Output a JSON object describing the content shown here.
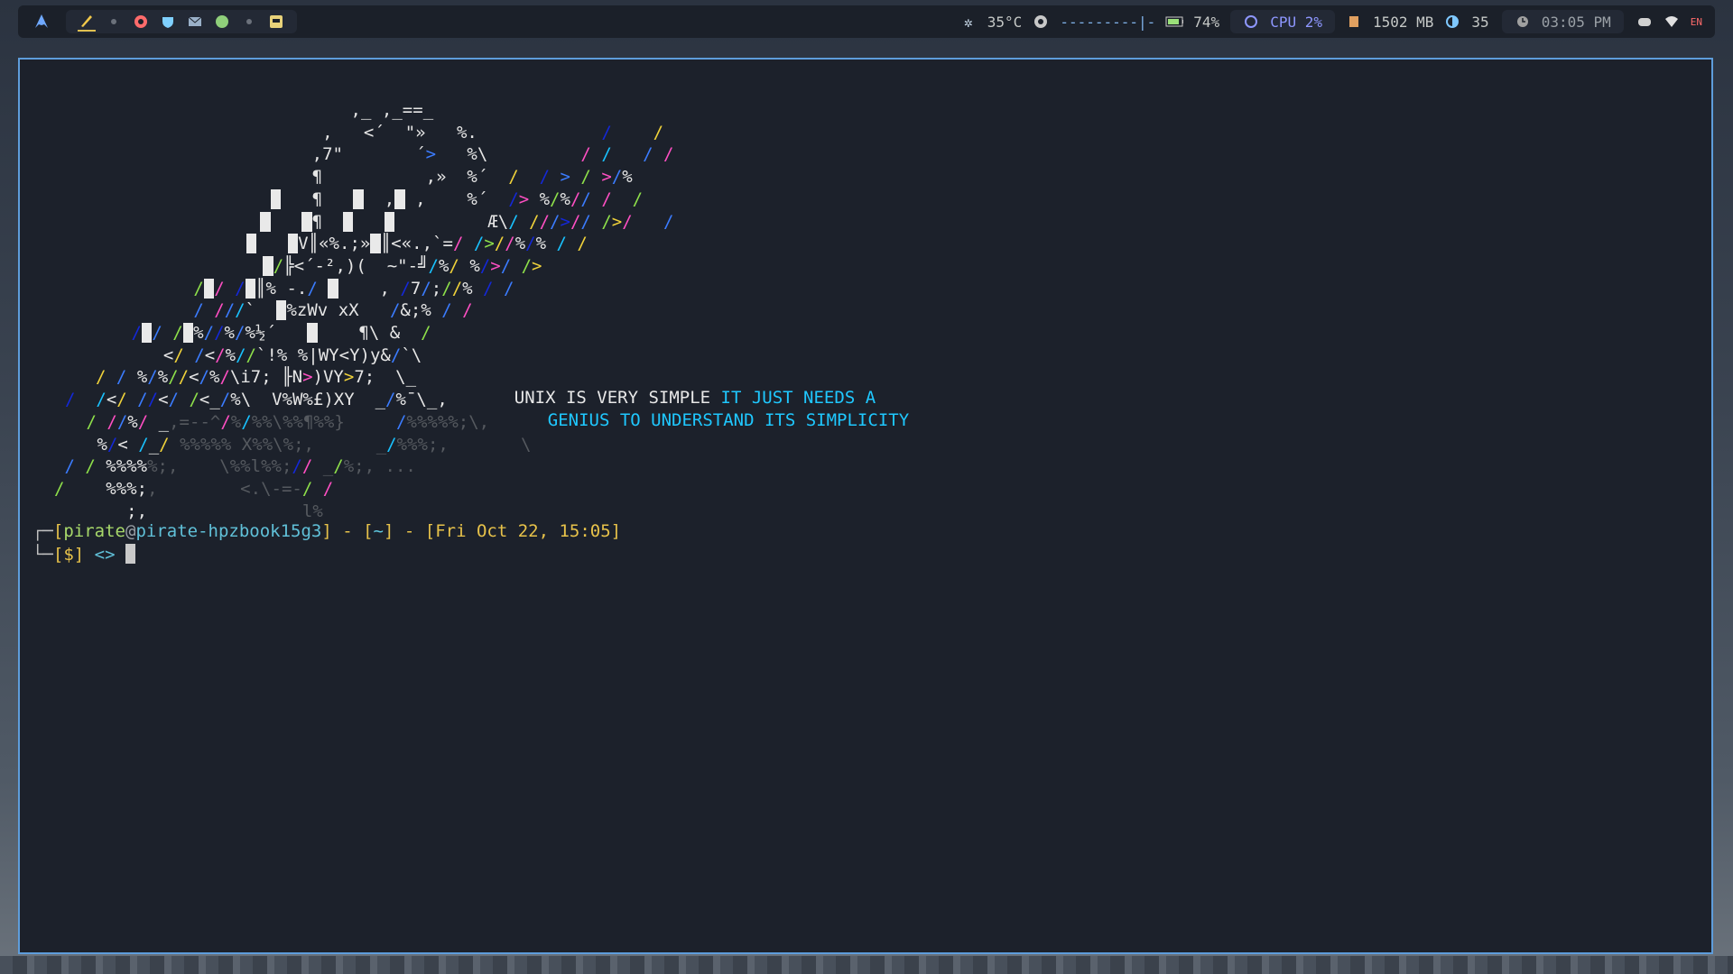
{
  "topbar": {
    "launcher_icon": "arch-a-icon",
    "workspace_apps": [
      "pen-icon",
      "dot-icon",
      "chrome-icon",
      "shield-icon",
      "mail-icon",
      "spotify-icon",
      "dot-icon",
      "discord-box-icon"
    ],
    "temperature": "35°C",
    "volume_bar": "---------|-",
    "battery": "74%",
    "cpu": "CPU 2%",
    "memory": "1502 MB",
    "brightness": "35",
    "clock": "03:05 PM",
    "lang": "EN",
    "colors": {
      "accent": "#5e9ddb",
      "bar_bg": "#1b2029",
      "cpu": "#7f88ff"
    }
  },
  "terminal": {
    "art_lines": [
      "          ,_ ,_==_",
      "         ,   <´  \"»   %.            /    /",
      "        ,7\"       ´>   %\\         / /   / /",
      "        ¶          ,»  %´  /  / > / >/%",
      "        ¶      ,  ,    %´  /> %/%// /  /",
      "        ¶                Æ\\/ ///>// />/   /",
      "       V║«%.;» ║<«.,`=/ />//%/% / /",
      "      /╠<´-²,)(  ~\"-╝/%/ %/>/ />",
      "   / / / ║% -./      , /7/;//% / /",
      "   / ///`   %zWv xX   /&;% / /",
      " / / / %//%/%½´        ¶\\ &  /",
      "  </ /</%//`!% %|WY<Y)y&/`\\",
      "/ / %/%//</%/\\i7; ╟N>)VY>7;  \\_",
      "/  /</ //</ /<_/%\\  V%W%£)XY  _/%¯\\_,",
      " / //%/ _,=--^/%/%%\\%%¶%%}     /%%%%%;\\,",
      " %/< /_/ %%%%% X%%\\%;,      _/%%%;,       \\",
      " / / %%%%%;,    \\%%l%%;// _/%;, ...",
      "/    %%%;,        <.\\-=-/ /",
      "       ;,               l%"
    ],
    "quote": {
      "part1": "UNIX IS VERY SIMPLE ",
      "part2": "IT JUST NEEDS A",
      "part3": "GENIUS TO UNDERSTAND ITS SIMPLICITY"
    },
    "prompt": {
      "corner_top": "┌─",
      "user": "pirate",
      "at": "@",
      "host": "pirate-hpzbook15g3",
      "sep1": "] - [",
      "dir": "~",
      "sep2": "] - [",
      "datetime": "Fri Oct 22, 15:05",
      "close": "]",
      "corner_bottom": "└─",
      "symbol": "[$]",
      "arrow": "<>"
    }
  }
}
